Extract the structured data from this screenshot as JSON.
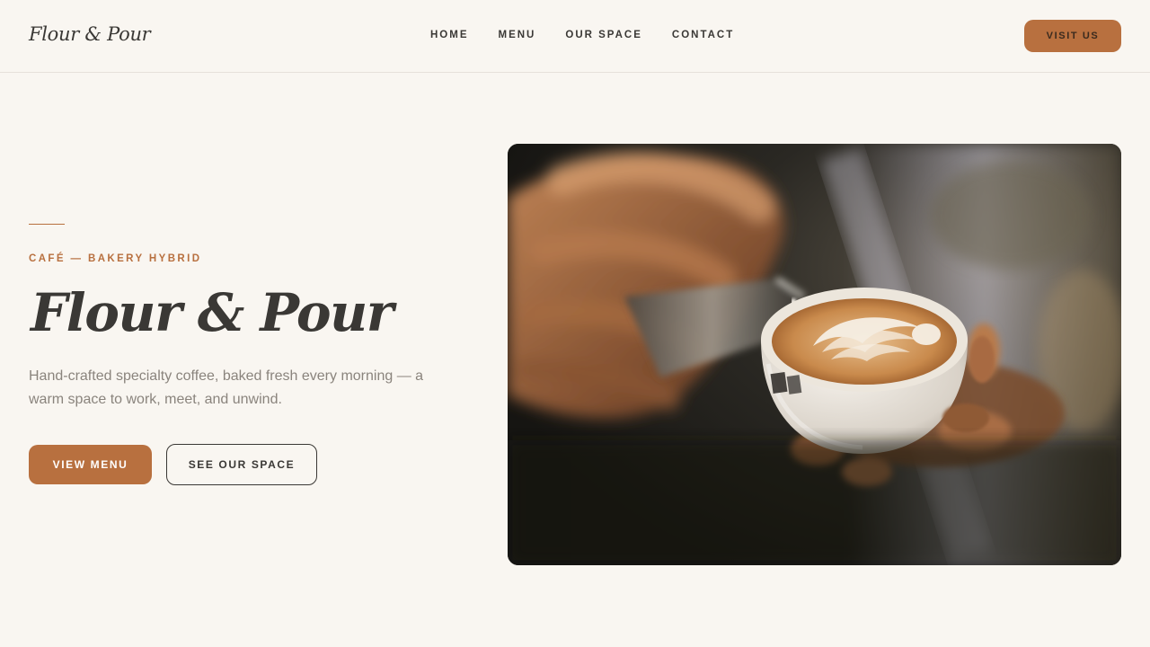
{
  "brand": {
    "logo_text": "Flour & Pour"
  },
  "nav": {
    "items": [
      {
        "label": "HOME"
      },
      {
        "label": "MENU"
      },
      {
        "label": "OUR SPACE"
      },
      {
        "label": "CONTACT"
      }
    ],
    "cta_label": "VISIT US"
  },
  "hero": {
    "eyebrow": "CAFÉ — BAKERY HYBRID",
    "title": "Flour & Pour",
    "description": "Hand-crafted specialty coffee, baked fresh every morning — a warm space to work, meet, and unwind.",
    "primary_button": "VIEW MENU",
    "secondary_button": "SEE OUR SPACE",
    "image_subject": "latte-art-pour-photo"
  },
  "colors": {
    "accent": "#b8703f",
    "background": "#f9f6f1",
    "text": "#3a3835",
    "muted_text": "#8a847d"
  }
}
